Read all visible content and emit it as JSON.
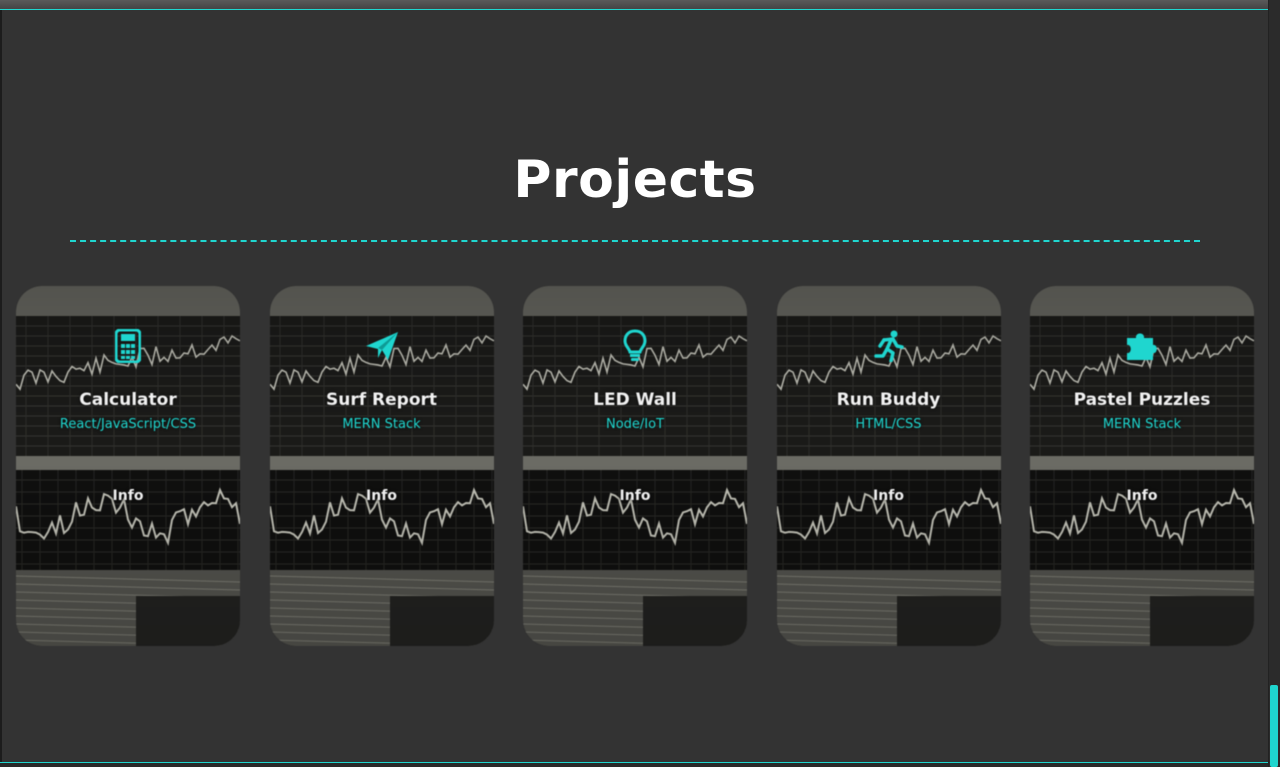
{
  "section": {
    "title": "Projects",
    "accent_color": "#1fd6cf",
    "background_color": "#333333"
  },
  "projects": [
    {
      "name": "Calculator",
      "stack": "React/JavaScript/CSS",
      "info_label": "Info",
      "icon": "calculator-icon"
    },
    {
      "name": "Surf Report",
      "stack": "MERN Stack",
      "info_label": "Info",
      "icon": "paper-plane-icon"
    },
    {
      "name": "LED Wall",
      "stack": "Node/IoT",
      "info_label": "Info",
      "icon": "lightbulb-icon"
    },
    {
      "name": "Run Buddy",
      "stack": "HTML/CSS",
      "info_label": "Info",
      "icon": "running-person-icon"
    },
    {
      "name": "Pastel Puzzles",
      "stack": "MERN Stack",
      "info_label": "Info",
      "icon": "puzzle-piece-icon"
    }
  ]
}
